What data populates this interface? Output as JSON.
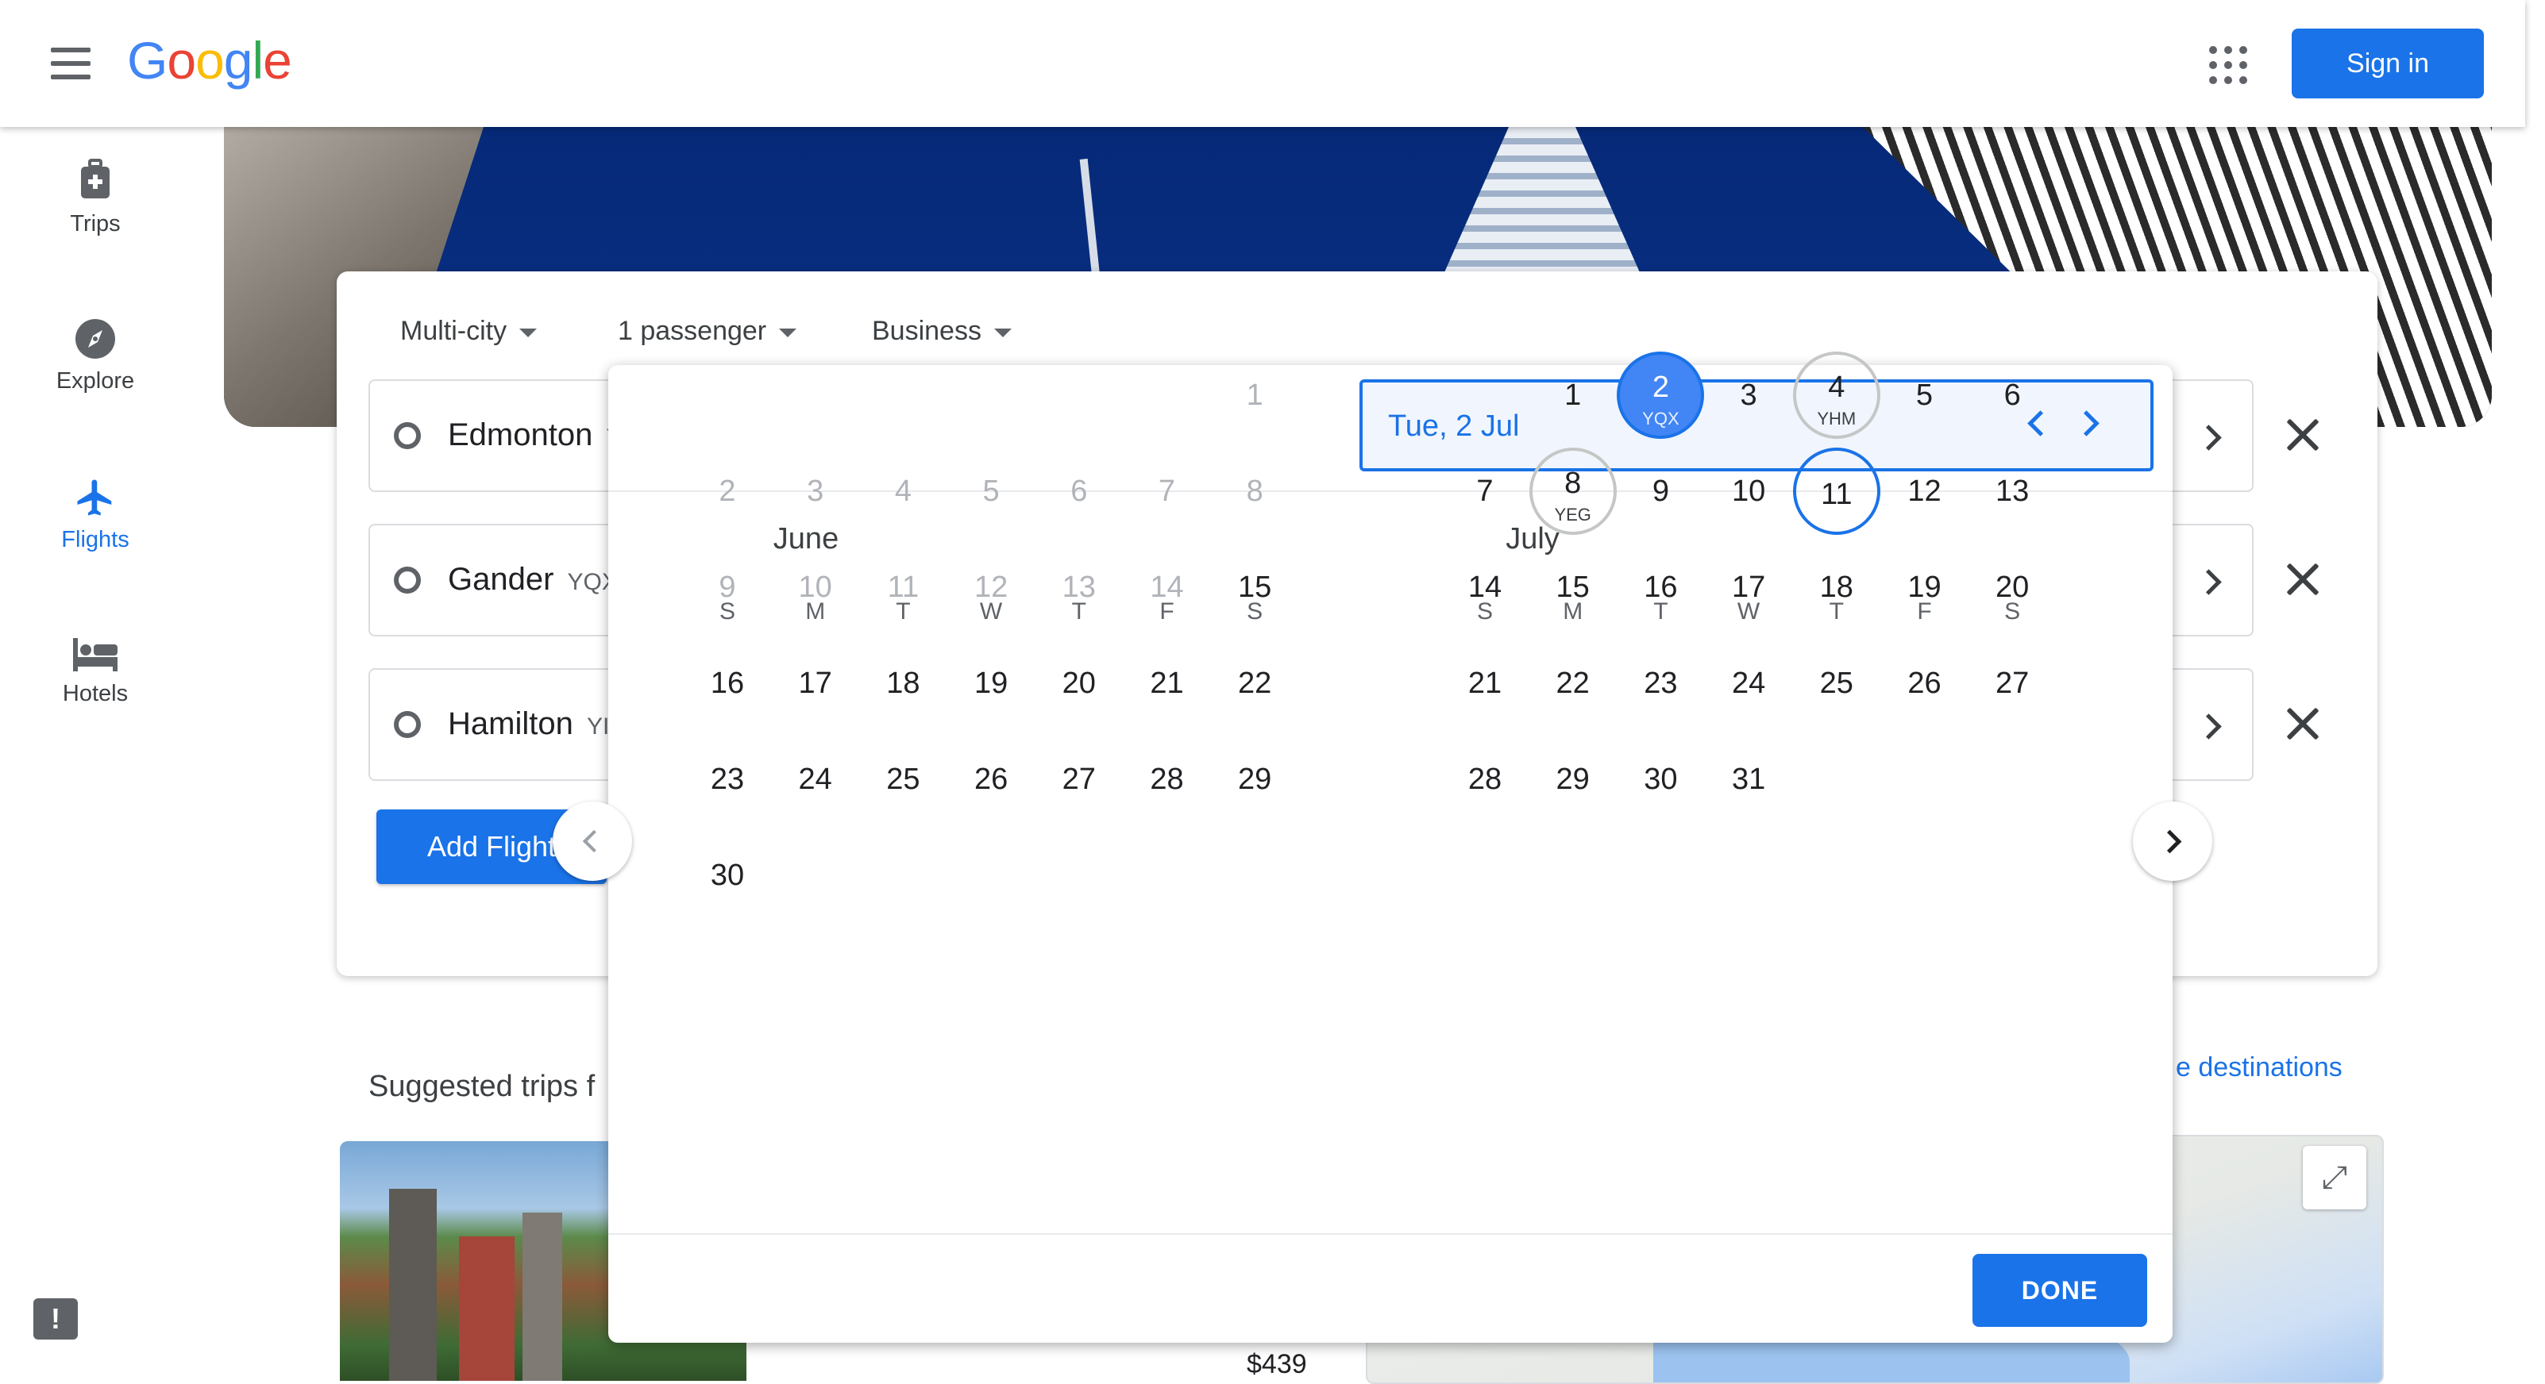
{
  "header": {
    "logo_letters": [
      "G",
      "o",
      "o",
      "g",
      "l",
      "e"
    ],
    "sign_in": "Sign in"
  },
  "sidebar": {
    "items": [
      {
        "label": "Trips",
        "icon": "luggage-icon",
        "active": false
      },
      {
        "label": "Explore",
        "icon": "compass-icon",
        "active": false
      },
      {
        "label": "Flights",
        "icon": "airplane-icon",
        "active": true
      },
      {
        "label": "Hotels",
        "icon": "bed-icon",
        "active": false
      }
    ]
  },
  "search": {
    "trip_type": "Multi-city",
    "passengers": "1 passenger",
    "cabin": "Business",
    "legs": [
      {
        "city": "Edmonton",
        "code": "Y"
      },
      {
        "city": "Gander",
        "code": "YQX"
      },
      {
        "city": "Hamilton",
        "code": "YI"
      }
    ],
    "add_flight": "Add Flight"
  },
  "below": {
    "suggested": "Suggested trips f",
    "destinations_link": "e destinations",
    "price": "$439"
  },
  "calendar": {
    "selected_date": "Tue, 2 Jul",
    "weekdays": [
      "S",
      "M",
      "T",
      "W",
      "T",
      "F",
      "S"
    ],
    "months": [
      {
        "name": "June",
        "first_weekday": 6,
        "days": 30,
        "disabled_through": 14
      },
      {
        "name": "July",
        "first_weekday": 1,
        "days": 31,
        "disabled_through": 0,
        "marked": [
          {
            "day": 2,
            "label": "YQX",
            "style": "selected"
          },
          {
            "day": 4,
            "label": "YHM",
            "style": "ring"
          },
          {
            "day": 8,
            "label": "YEG",
            "style": "ring"
          },
          {
            "day": 11,
            "label": "",
            "style": "current"
          }
        ]
      }
    ],
    "done": "DONE"
  },
  "colors": {
    "accent": "#1a73e8",
    "selected_fill": "#4285f4",
    "disabled_text": "#b0b3b8"
  }
}
